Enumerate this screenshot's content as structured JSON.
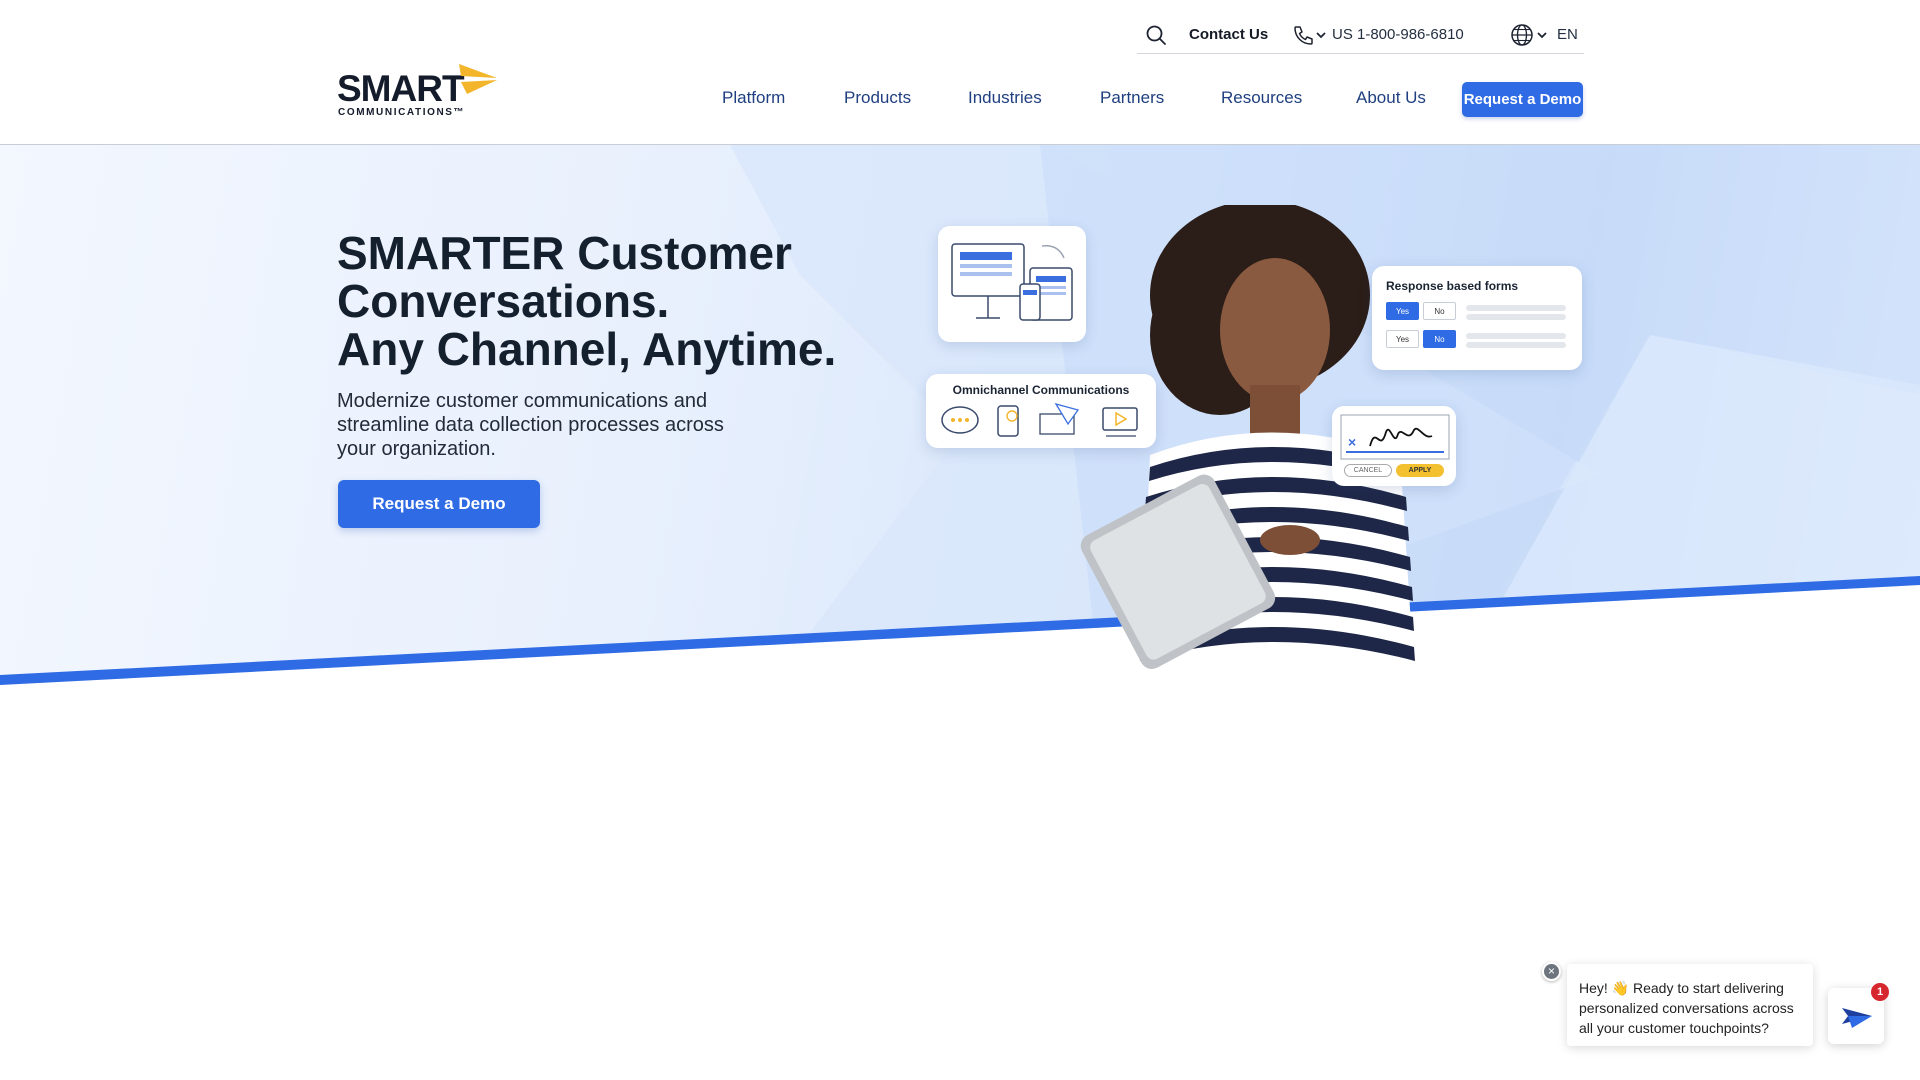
{
  "utility_bar": {
    "contact_label": "Contact Us",
    "phone_number": "US 1-800-986-6810",
    "language": "EN",
    "icons": [
      "search-icon",
      "phone-icon",
      "globe-icon",
      "chevron-down-icon"
    ]
  },
  "logo": {
    "text": "SMART",
    "subtext": "COMMUNICATIONS™",
    "mark_color": "#f3b52a"
  },
  "nav": {
    "items": [
      {
        "label": "Platform"
      },
      {
        "label": "Products"
      },
      {
        "label": "Industries"
      },
      {
        "label": "Partners"
      },
      {
        "label": "Resources"
      },
      {
        "label": "About Us"
      }
    ],
    "cta_label": "Request a Demo"
  },
  "hero": {
    "title_line1": "SMARTER Customer",
    "title_line2": "Conversations.",
    "title_line3": "Any Channel, Anytime.",
    "description": "Modernize customer communications and streamline data collection processes across your organization.",
    "cta_label": "Request a Demo",
    "cards": {
      "omnichannel_title": "Omnichannel Communications",
      "forms_title": "Response based forms",
      "yes_label": "Yes",
      "no_label": "No",
      "cancel_label": "CANCEL",
      "apply_label": "APPLY"
    }
  },
  "chat": {
    "message": "Hey! 👋 Ready to start delivering personalized conversations across all your customer touchpoints?",
    "badge_count": "1",
    "close_symbol": "×"
  },
  "colors": {
    "brand_blue": "#2f6be4",
    "nav_text": "#1f3f80",
    "heading": "#15202e",
    "accent_yellow": "#f3b52a"
  }
}
